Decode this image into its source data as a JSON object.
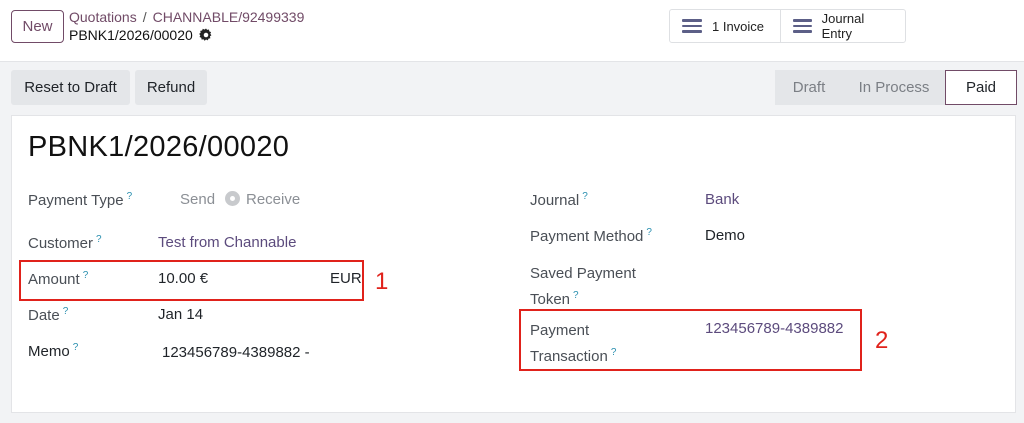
{
  "topbar": {
    "new_label": "New",
    "breadcrumb": {
      "parent": "Quotations",
      "separator": "/",
      "current": "CHANNABLE/92499339"
    },
    "record_name": "PBNK1/2026/00020",
    "smart_buttons": {
      "invoice_label": "1 Invoice",
      "journal_label": "Journal Entry"
    }
  },
  "actions": {
    "reset_label": "Reset to Draft",
    "refund_label": "Refund"
  },
  "status": {
    "stages": [
      "Draft",
      "In Process",
      "Paid"
    ],
    "current": "Paid"
  },
  "form": {
    "title": "PBNK1/2026/00020",
    "help_mark": "?",
    "payment_type": {
      "label": "Payment Type",
      "option_send": "Send",
      "option_receive": "Receive"
    },
    "customer": {
      "label": "Customer",
      "value": "Test from Channable"
    },
    "amount": {
      "label": "Amount",
      "value": "10.00 €",
      "currency": "EUR"
    },
    "date": {
      "label": "Date",
      "value": "Jan 14"
    },
    "memo": {
      "label": "Memo",
      "value": "123456789-4389882 -"
    },
    "journal": {
      "label": "Journal",
      "value": "Bank"
    },
    "payment_method": {
      "label": "Payment Method",
      "value": "Demo"
    },
    "saved_token": {
      "label_line1": "Saved Payment",
      "label_line2": "Token"
    },
    "payment_transaction": {
      "label_line1": "Payment",
      "label_line2": "Transaction",
      "value": "123456789-4389882"
    }
  },
  "annotations": {
    "box1": "1",
    "box2": "2"
  },
  "colors": {
    "brand": "#714b67",
    "highlight": "#e0221b",
    "link": "#5c4b7d",
    "help": "#2b90b0"
  }
}
